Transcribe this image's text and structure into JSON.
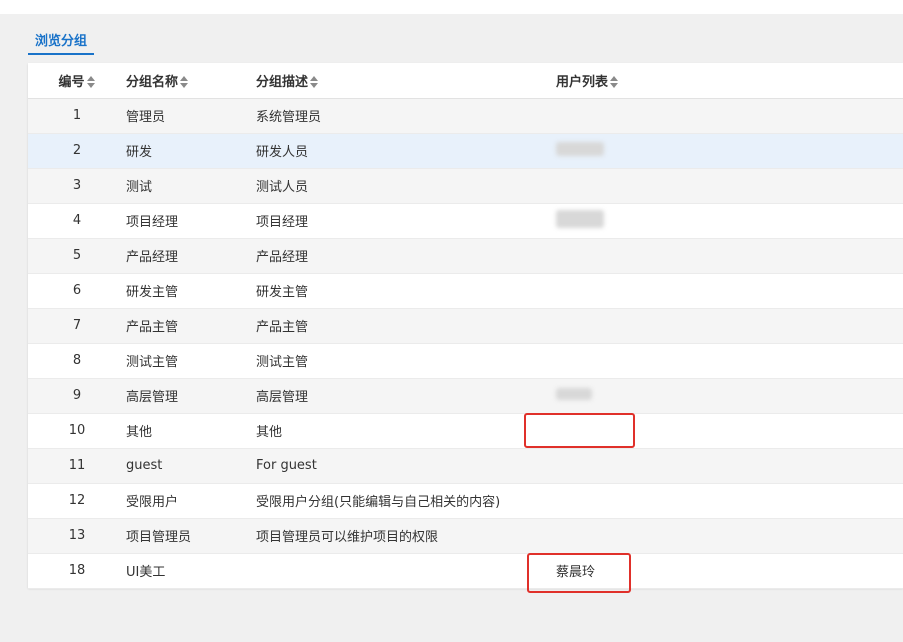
{
  "tabs": [
    {
      "label": "浏览分组"
    }
  ],
  "table": {
    "columns": [
      {
        "label": "编号"
      },
      {
        "label": "分组名称"
      },
      {
        "label": "分组描述"
      },
      {
        "label": "用户列表"
      }
    ],
    "rows": [
      {
        "id": "1",
        "name": "管理员",
        "desc": "系统管理员",
        "users": ""
      },
      {
        "id": "2",
        "name": "研发",
        "desc": "研发人员",
        "users": ""
      },
      {
        "id": "3",
        "name": "测试",
        "desc": "测试人员",
        "users": ""
      },
      {
        "id": "4",
        "name": "项目经理",
        "desc": "项目经理",
        "users": ""
      },
      {
        "id": "5",
        "name": "产品经理",
        "desc": "产品经理",
        "users": ""
      },
      {
        "id": "6",
        "name": "研发主管",
        "desc": "研发主管",
        "users": ""
      },
      {
        "id": "7",
        "name": "产品主管",
        "desc": "产品主管",
        "users": ""
      },
      {
        "id": "8",
        "name": "测试主管",
        "desc": "测试主管",
        "users": ""
      },
      {
        "id": "9",
        "name": "高层管理",
        "desc": "高层管理",
        "users": ""
      },
      {
        "id": "10",
        "name": "其他",
        "desc": "其他",
        "users": ""
      },
      {
        "id": "11",
        "name": "guest",
        "desc": "For guest",
        "users": ""
      },
      {
        "id": "12",
        "name": "受限用户",
        "desc": "受限用户分组(只能编辑与自己相关的内容)",
        "users": ""
      },
      {
        "id": "13",
        "name": "项目管理员",
        "desc": "项目管理员可以维护项目的权限",
        "users": ""
      },
      {
        "id": "18",
        "name": "UI美工",
        "desc": "",
        "users": "蔡晨玲"
      }
    ]
  },
  "colors": {
    "accent": "#1a73c9",
    "highlight_box": "#e0302a",
    "selected_row": "#e8f1fb"
  }
}
